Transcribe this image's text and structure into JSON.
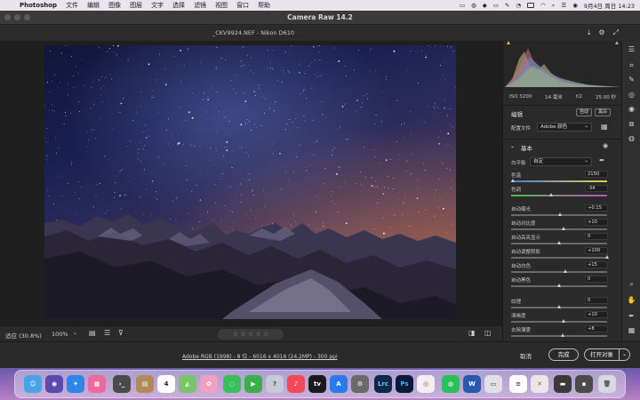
{
  "menubar": {
    "app_name": "Photoshop",
    "items": [
      "文件",
      "编辑",
      "图像",
      "图层",
      "文字",
      "选择",
      "滤镜",
      "视图",
      "窗口",
      "帮助"
    ],
    "date_time": "9月4日 周日 14:23"
  },
  "window": {
    "title": "Camera Raw 14.2"
  },
  "file": {
    "name": "_CKV9924.NEF  -  Nikon D610"
  },
  "histogram_info": {
    "iso": "ISO 3200",
    "focal": "14 毫米",
    "aperture": "f/2",
    "shutter": "25.00 秒"
  },
  "edit": {
    "title": "编辑",
    "auto_button": "自动",
    "bw_button": "黑白",
    "profile_label": "配置文件",
    "profile_value": "Adobe 颜色",
    "basic_title": "基本",
    "wb_label": "白平衡",
    "wb_value": "自定"
  },
  "sliders": [
    {
      "label": "色温",
      "value": "2150",
      "pos": 0.02,
      "gradient": "temp"
    },
    {
      "label": "色调",
      "value": "-34",
      "pos": 0.42,
      "gradient": "tint"
    },
    {
      "label": "自动曝光",
      "value": "+0.15",
      "pos": 0.51
    },
    {
      "label": "自动对比度",
      "value": "+10",
      "pos": 0.55
    },
    {
      "label": "自动高亮显示",
      "value": "0",
      "pos": 0.5
    },
    {
      "label": "自动调整阴影",
      "value": "+100",
      "pos": 1.0
    },
    {
      "label": "自动白色",
      "value": "+15",
      "pos": 0.57
    },
    {
      "label": "自动黑色",
      "value": "0",
      "pos": 0.5
    },
    {
      "label": "纹理",
      "value": "0",
      "pos": 0.5
    },
    {
      "label": "清晰度",
      "value": "+10",
      "pos": 0.55
    },
    {
      "label": "去除薄雾",
      "value": "+8",
      "pos": 0.54
    }
  ],
  "image_toolbar": {
    "fit_label": "适应 (30.8%)",
    "zoom_value": "100%",
    "stars": "☆ ☆ ☆ ☆ ☆"
  },
  "footer": {
    "meta": "Adobe RGB (1998) - 8 位 - 6016 x 4016 (24.2MP) - 300 ppi",
    "cancel": "取消",
    "done": "完成",
    "open": "打开对象"
  },
  "dock": {
    "calendar_day": "4",
    "lrc_label": "Lrc",
    "ps_label": "Ps",
    "tv_label": "tv"
  },
  "colors": {
    "panel_bg": "#2a2a2a",
    "accent": "#e5b6e0"
  }
}
